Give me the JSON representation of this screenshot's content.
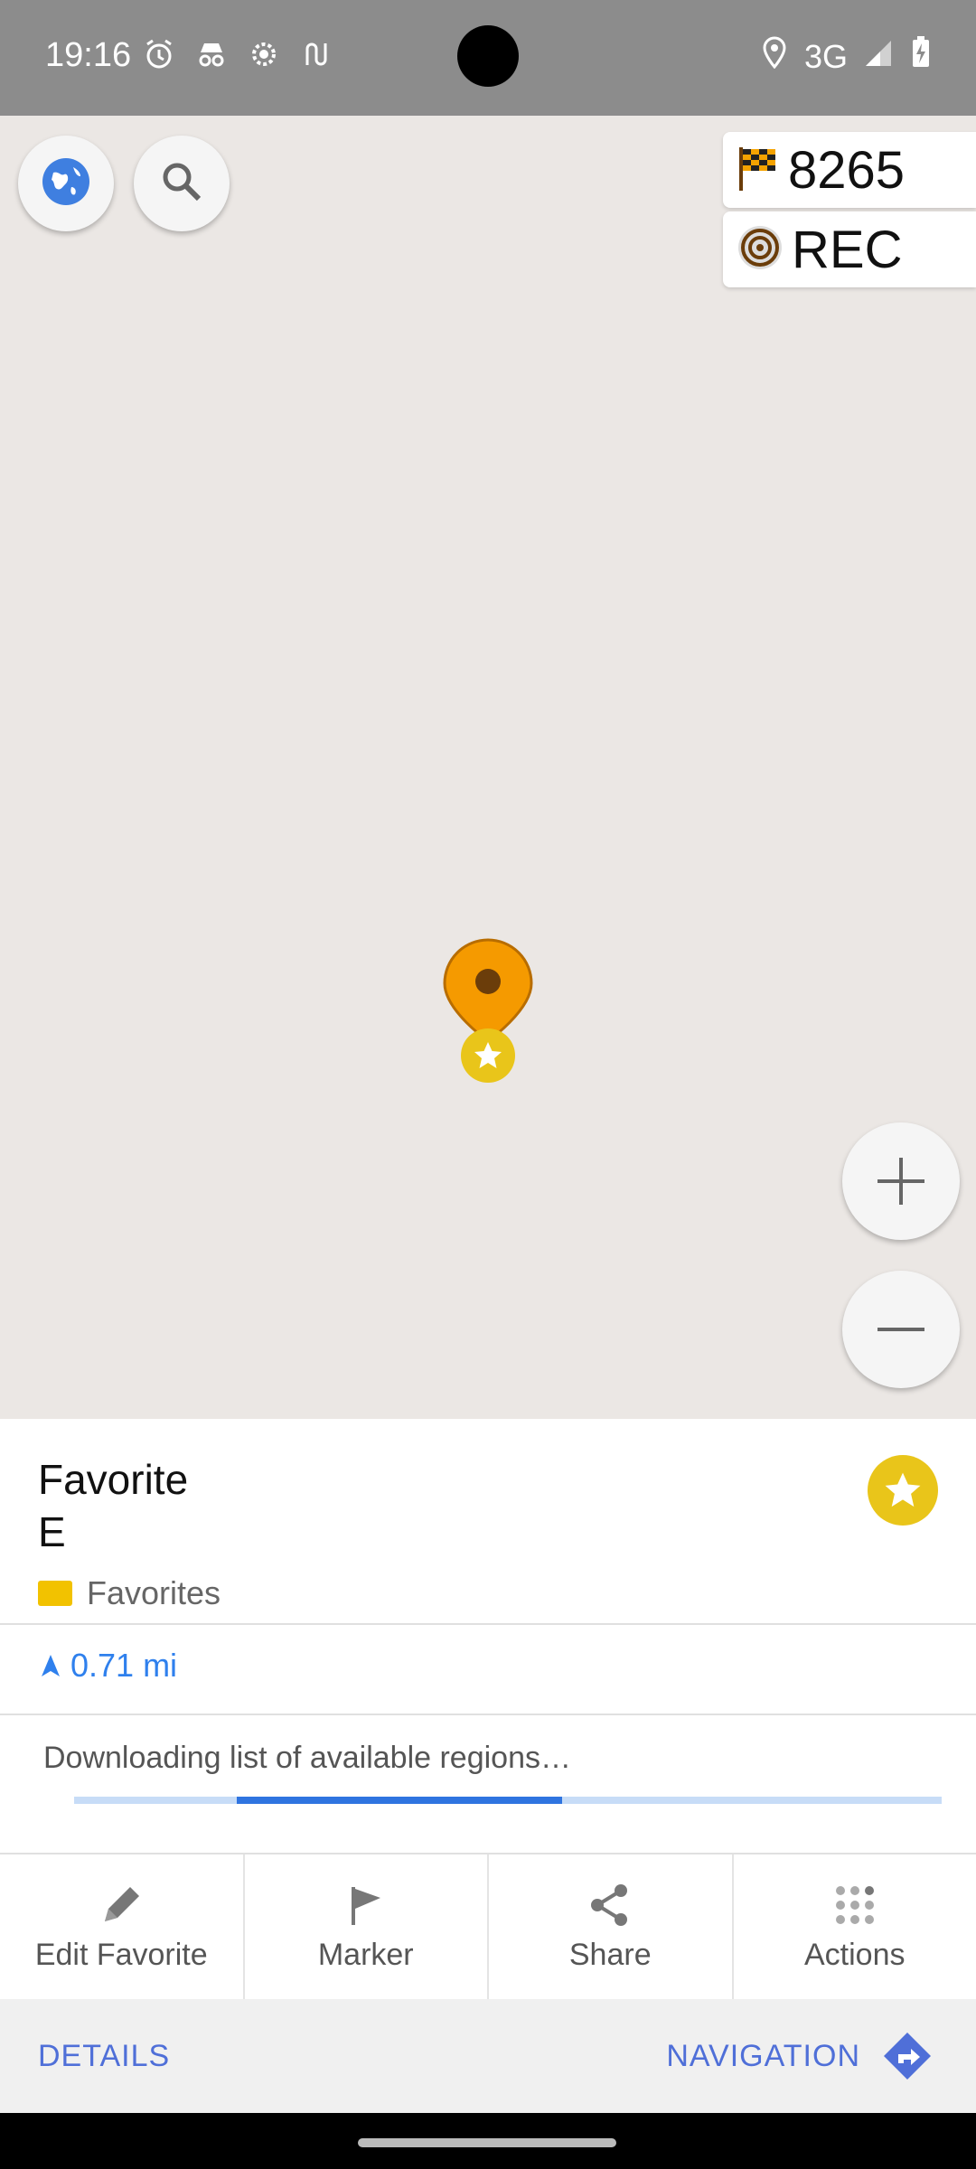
{
  "status_bar": {
    "time": "19:16",
    "network": "3G",
    "icons_left": [
      "alarm-icon",
      "incognito-icon",
      "settings-icon",
      "route-icon"
    ],
    "icons_right": [
      "location-icon",
      "signal-icon",
      "battery-charging-icon"
    ]
  },
  "map_controls": {
    "globe_button": "globe-icon",
    "search_button": "search-icon",
    "zoom_in": "plus-icon",
    "zoom_out": "minus-icon"
  },
  "widgets": {
    "distance_to_finish": "8265",
    "recording_label": "REC"
  },
  "favorite": {
    "title": "Favorite E",
    "group": "Favorites",
    "distance": "0.71 mi"
  },
  "download": {
    "text": "Downloading list of available regions…",
    "progress": 0.61
  },
  "actions": [
    {
      "label": "Edit Favorite",
      "icon": "pencil-icon"
    },
    {
      "label": "Marker",
      "icon": "flag-icon"
    },
    {
      "label": "Share",
      "icon": "share-icon"
    },
    {
      "label": "Actions",
      "icon": "dots-grid-icon"
    }
  ],
  "bottom": {
    "details": "DETAILS",
    "navigation": "NAVIGATION"
  },
  "colors": {
    "accent": "#4f6fd8",
    "map_bg": "#ebe7e4",
    "pin": "#f59a00",
    "star": "#e9c51a"
  }
}
